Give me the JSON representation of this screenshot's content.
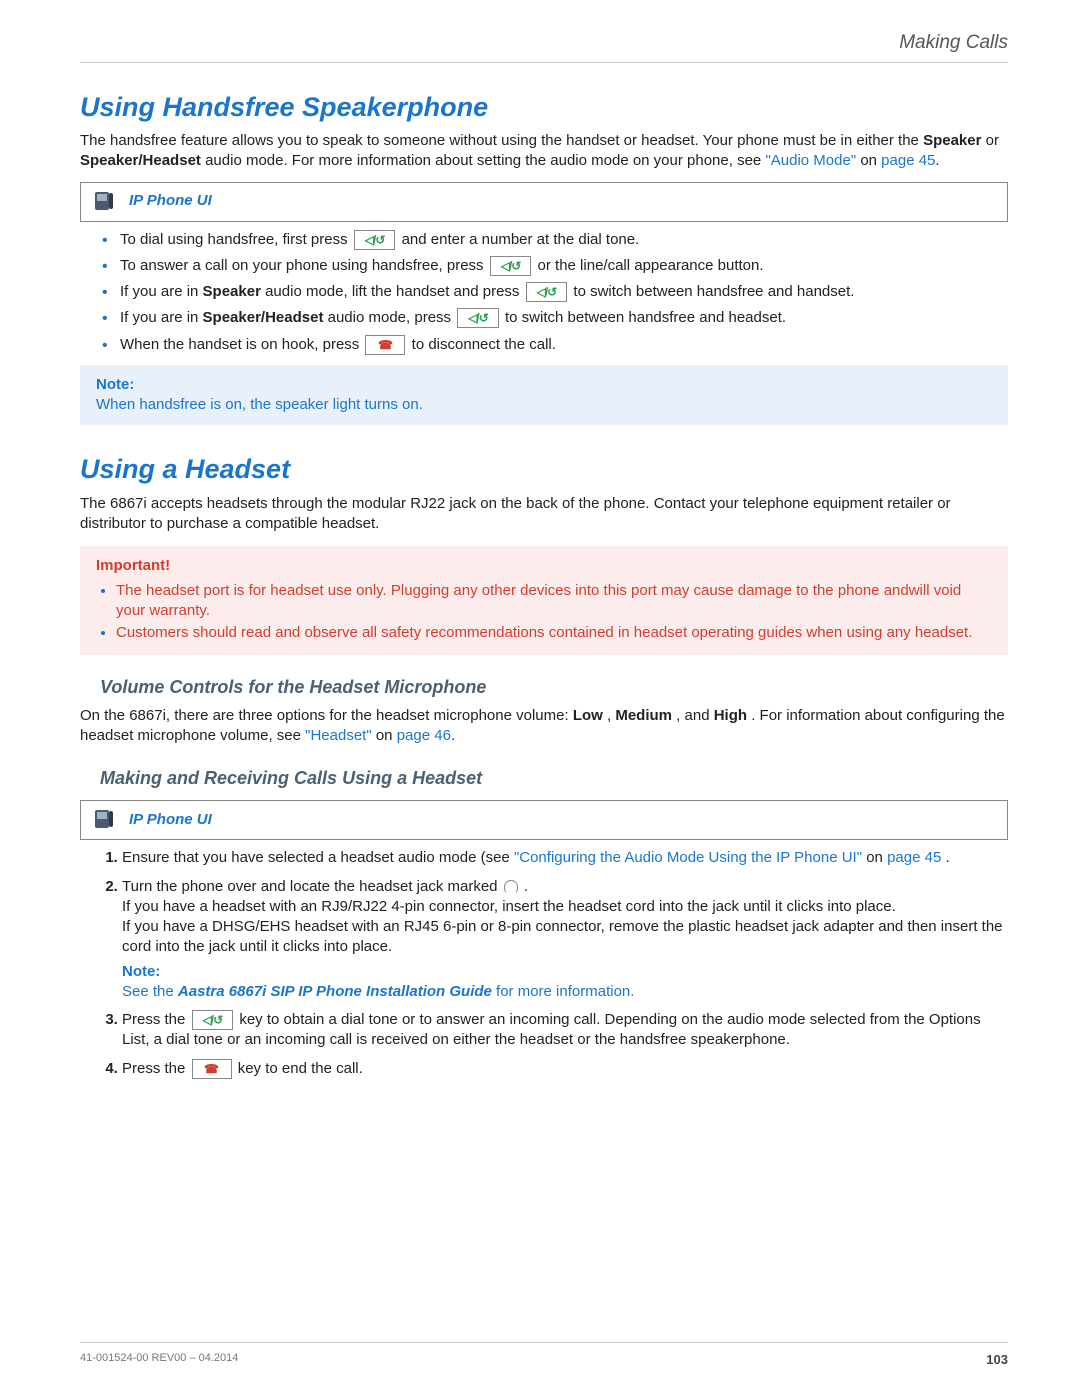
{
  "header": {
    "breadcrumb": "Making Calls"
  },
  "section1": {
    "title": "Using Handsfree Speakerphone",
    "intro_a": "The handsfree feature allows you to speak to someone without using the handset or headset. Your phone must be in either the ",
    "intro_b1": "Speaker",
    "intro_mid": " or ",
    "intro_b2": "Speaker/Headset",
    "intro_c": " audio mode. For more information about setting the audio mode on your phone, see ",
    "intro_link": "\"Audio Mode\"",
    "intro_onpage": " on ",
    "intro_page": "page 45",
    "ui_label": "IP Phone UI",
    "bullets": {
      "b1a": "To dial using handsfree, first press ",
      "b1b": " and enter a number at the dial tone.",
      "b2a": "To answer a call on your phone using handsfree, press ",
      "b2b": " or the line/call appearance button.",
      "b3a": "If you are in ",
      "b3bold": "Speaker",
      "b3b": " audio mode, lift the handset and press ",
      "b3c": " to switch between handsfree and handset.",
      "b4a": "If you are in ",
      "b4bold": "Speaker/Headset",
      "b4b": " audio mode, press ",
      "b4c": " to switch between handsfree and headset.",
      "b5a": "When the handset is on hook, press ",
      "b5b": " to disconnect the call."
    },
    "note_head": "Note:",
    "note_body": "When handsfree is on, the speaker light turns on."
  },
  "section2": {
    "title": "Using a Headset",
    "intro": "The 6867i accepts headsets through the modular RJ22 jack on the back of the phone. Contact your telephone equipment retailer or distributor to purchase a compatible headset.",
    "imp_head": "Important!",
    "imp1": "The headset port is for headset use only. Plugging any other devices into this port may cause damage to the phone andwill void your warranty.",
    "imp2": "Customers should read and observe all safety recommendations contained in headset operating guides when using any headset.",
    "sub1_title": "Volume Controls for the Headset Microphone",
    "sub1_a": "On the 6867i, there are three options for the headset microphone volume: ",
    "sub1_low": "Low",
    "sub1_sep1": ", ",
    "sub1_med": "Medium",
    "sub1_sep2": ", and ",
    "sub1_high": "High",
    "sub1_b": ". For information about configuring the headset microphone volume, see ",
    "sub1_link": "\"Headset\"",
    "sub1_on": " on ",
    "sub1_page": "page 46",
    "sub2_title": "Making and Receiving Calls Using a Headset",
    "ui_label": "IP Phone UI",
    "step1a": "Ensure that you have selected a headset audio mode (see ",
    "step1link": "\"Configuring the Audio Mode Using the IP Phone UI\"",
    "step1on": " on ",
    "step1page": "page 45",
    "step1dot": ".",
    "step2a": "Turn the phone over and locate the headset jack marked ",
    "step2b": ".",
    "step2c": "If you have a headset with an RJ9/RJ22 4-pin connector, insert the headset cord into the jack until it clicks into place.",
    "step2d": "If you have a DHSG/EHS headset with an RJ45 6-pin or 8-pin connector, remove the plastic headset jack adapter and then insert the cord into the jack until it clicks into place.",
    "step2_note_t": "Note:",
    "step2_note_a": "See the ",
    "step2_note_b": "Aastra 6867i SIP IP Phone Installation Guide",
    "step2_note_c": " for more information.",
    "step3a": "Press the ",
    "step3b": " key to obtain a dial tone or to answer an incoming call. Depending on the audio mode selected from the Options List, a dial tone or an incoming call is received on either the headset or the handsfree speakerphone.",
    "step4a": "Press the ",
    "step4b": " key to end the call."
  },
  "footer": {
    "docid": "41-001524-00 REV00 – 04.2014",
    "page": "103"
  },
  "icons": {
    "speaker_key": "◁/↺",
    "hangup_key": "☎"
  }
}
